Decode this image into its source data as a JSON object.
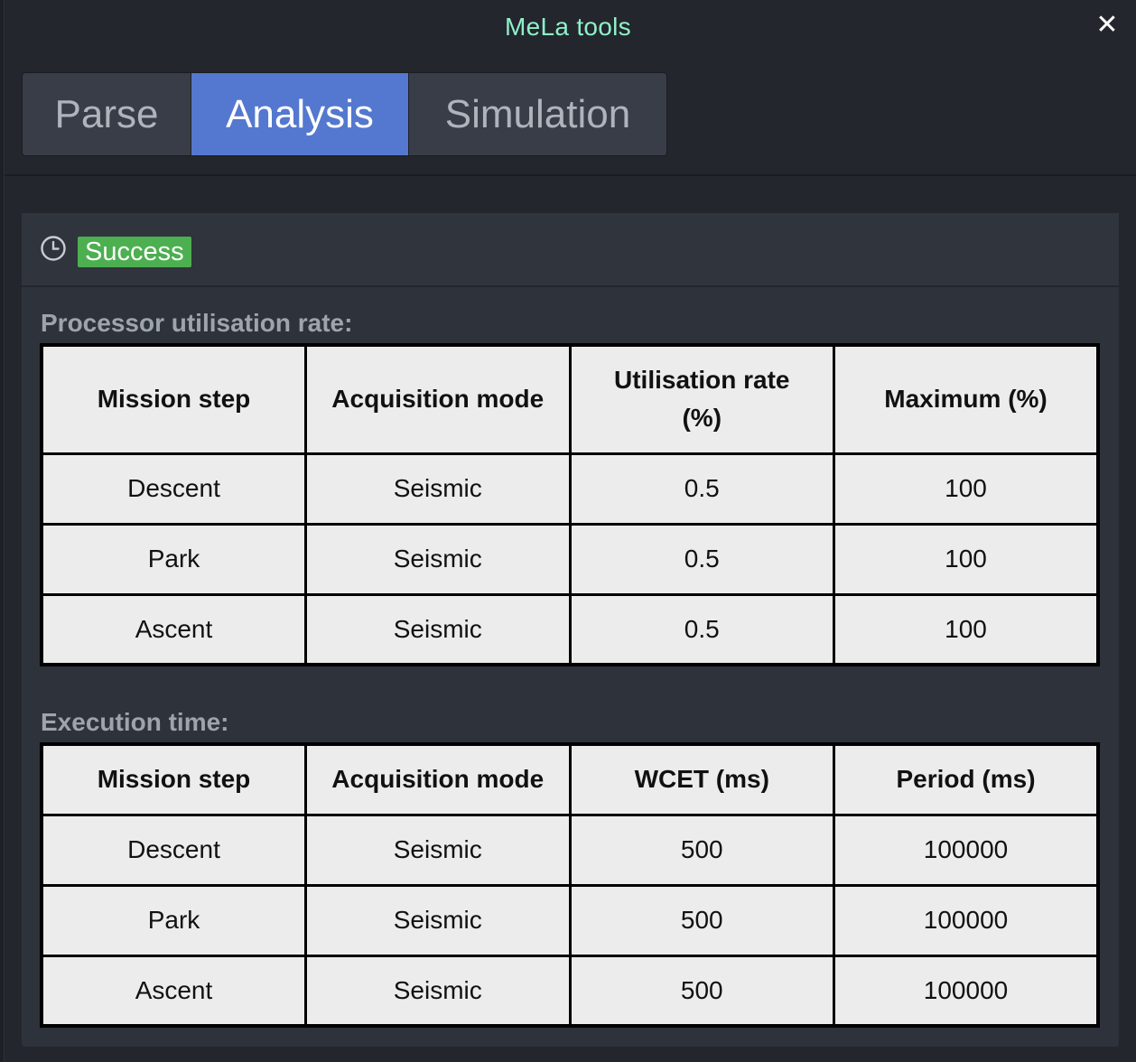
{
  "window": {
    "title": "MeLa tools",
    "close_icon": "close-icon"
  },
  "tabs": [
    {
      "label": "Parse",
      "active": false
    },
    {
      "label": "Analysis",
      "active": true
    },
    {
      "label": "Simulation",
      "active": false
    }
  ],
  "status": {
    "icon": "clock-icon",
    "badge": "Success",
    "badge_color": "#4caf50"
  },
  "utilisation": {
    "label": "Processor utilisation rate:",
    "headers": [
      "Mission step",
      "Acquisition mode",
      "Utilisation rate (%)",
      "Maximum (%)"
    ],
    "rows": [
      [
        "Descent",
        "Seismic",
        "0.5",
        "100"
      ],
      [
        "Park",
        "Seismic",
        "0.5",
        "100"
      ],
      [
        "Ascent",
        "Seismic",
        "0.5",
        "100"
      ]
    ]
  },
  "execution": {
    "label": "Execution time:",
    "headers": [
      "Mission step",
      "Acquisition mode",
      "WCET (ms)",
      "Period (ms)"
    ],
    "rows": [
      [
        "Descent",
        "Seismic",
        "500",
        "100000"
      ],
      [
        "Park",
        "Seismic",
        "500",
        "100000"
      ],
      [
        "Ascent",
        "Seismic",
        "500",
        "100000"
      ]
    ]
  },
  "colors": {
    "accent": "#5478cf",
    "title": "#8ff0c8",
    "background": "#23262d"
  }
}
